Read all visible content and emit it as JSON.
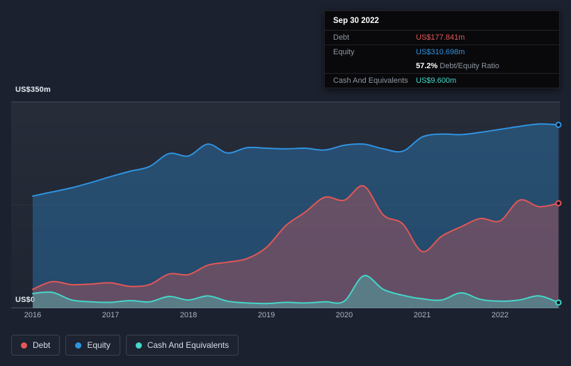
{
  "tooltip": {
    "date": "Sep 30 2022",
    "rows": [
      {
        "label": "Debt",
        "value": "US$177.841m",
        "color": "#e25757"
      },
      {
        "label": "Equity",
        "value": "US$310.698m",
        "color": "#2f93e0"
      },
      {
        "label": "",
        "value_bold": "57.2%",
        "value_rest": " Debt/Equity Ratio"
      },
      {
        "label": "Cash And Equivalents",
        "value": "US$9.600m",
        "color": "#45d6c9"
      }
    ]
  },
  "axis": {
    "y_top": "US$350m",
    "y_bottom": "US$0",
    "x_ticks": [
      "2016",
      "2017",
      "2018",
      "2019",
      "2020",
      "2021",
      "2022"
    ]
  },
  "legend": {
    "items": [
      {
        "label": "Debt",
        "color": "#e25757"
      },
      {
        "label": "Equity",
        "color": "#2f93e0"
      },
      {
        "label": "Cash And Equivalents",
        "color": "#45d6c9"
      }
    ]
  },
  "chart_data": {
    "type": "area",
    "x_start": 2016,
    "x_end": 2022.75,
    "ylim": [
      0,
      350
    ],
    "grid": "horizontal-minimal",
    "legend_position": "bottom-left",
    "x": [
      2016.0,
      2016.25,
      2016.5,
      2016.75,
      2017.0,
      2017.25,
      2017.5,
      2017.75,
      2018.0,
      2018.25,
      2018.5,
      2018.75,
      2019.0,
      2019.25,
      2019.5,
      2019.75,
      2020.0,
      2020.25,
      2020.5,
      2020.75,
      2021.0,
      2021.25,
      2021.5,
      2021.75,
      2022.0,
      2022.25,
      2022.5,
      2022.75
    ],
    "series": [
      {
        "name": "Debt",
        "color": "#e25757",
        "values": [
          32,
          45,
          40,
          41,
          43,
          37,
          40,
          58,
          57,
          73,
          78,
          84,
          103,
          140,
          163,
          188,
          183,
          207,
          158,
          143,
          96,
          122,
          138,
          152,
          148,
          183,
          172,
          177.841
        ]
      },
      {
        "name": "Equity",
        "color": "#2f93e0",
        "values": [
          190,
          197,
          204,
          213,
          223,
          232,
          240,
          262,
          258,
          278,
          263,
          272,
          271,
          270,
          271,
          268,
          276,
          278,
          270,
          266,
          290,
          295,
          294,
          298,
          303,
          308,
          312,
          310.698
        ]
      },
      {
        "name": "Cash And Equivalents",
        "color": "#45d6c9",
        "values": [
          25,
          27,
          14,
          11,
          10,
          13,
          11,
          20,
          14,
          21,
          12,
          9,
          8,
          10,
          9,
          11,
          12,
          55,
          32,
          22,
          16,
          14,
          26,
          15,
          12,
          14,
          21,
          9.6
        ]
      }
    ]
  }
}
